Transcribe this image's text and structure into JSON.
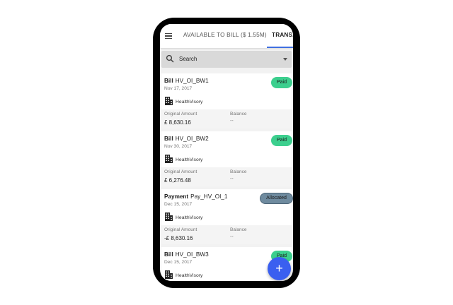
{
  "header": {
    "tabs": [
      {
        "label": "AVAILABLE TO BILL ($ 1.55M)"
      },
      {
        "label": "TRANSA"
      }
    ]
  },
  "search": {
    "placeholder": "Search"
  },
  "cards": [
    {
      "type": "Bill",
      "name": "HV_OI_BW1",
      "date": "Nov 17, 2017",
      "company": "HealthVisory",
      "status": "Paid",
      "original_label": "Original Amount",
      "original_value": "£ 8,630.16",
      "balance_label": "Balance",
      "balance_value": "--"
    },
    {
      "type": "Bill",
      "name": "HV_OI_BW2",
      "date": "Nov 30, 2017",
      "company": "HealthVisory",
      "status": "Paid",
      "original_label": "Original Amount",
      "original_value": "£ 6,276.48",
      "balance_label": "Balance",
      "balance_value": "--"
    },
    {
      "type": "Payment",
      "name": "Pay_HV_OI_1",
      "date": "Dec 15, 2017",
      "company": "HealthVisory",
      "status": "Allocated",
      "original_label": "Original Amount",
      "original_value": "-£ 8,630.16",
      "balance_label": "Balance",
      "balance_value": "--"
    },
    {
      "type": "Bill",
      "name": "HV_OI_BW3",
      "date": "Dec 15, 2017",
      "company": "HealthVisory",
      "status": "Paid"
    }
  ],
  "fab": {
    "label": "+"
  },
  "colors": {
    "accent": "#3a5ff0",
    "paid": "#3ccf8e",
    "allocated": "#6f8b9f"
  }
}
